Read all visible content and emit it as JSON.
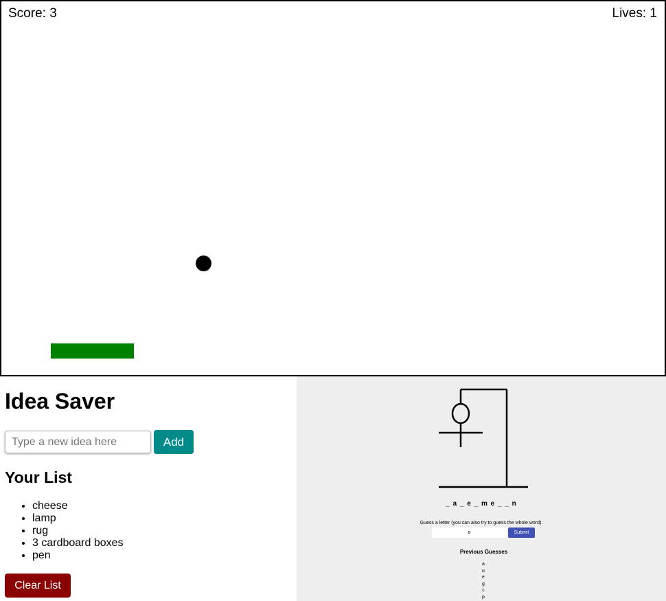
{
  "breakout": {
    "score_text": "Score: 3",
    "lives_text": "Lives: 1",
    "paddle_color": "#008000",
    "ball_color": "#000000"
  },
  "idea_saver": {
    "title": "Idea Saver",
    "input_placeholder": "Type a new idea here",
    "add_label": "Add",
    "add_color": "#008b8b",
    "list_title": "Your List",
    "items": [
      "cheese",
      "lamp",
      "rug",
      "3 cardboard boxes",
      "pen"
    ],
    "clear_label": "Clear List",
    "clear_color": "#8b0000"
  },
  "hangman": {
    "background": "#eeeeee",
    "word_display": "_ a _ e _ m e _ _ n",
    "prompt": "Guess a letter (you can also try to guess the whole word):",
    "guess_value": "o",
    "submit_label": "Submit",
    "submit_color": "#3f51b5",
    "previous_title": "Previous Guesses",
    "previous_guesses": [
      "a",
      "u",
      "e",
      "g",
      "c",
      "p"
    ]
  }
}
